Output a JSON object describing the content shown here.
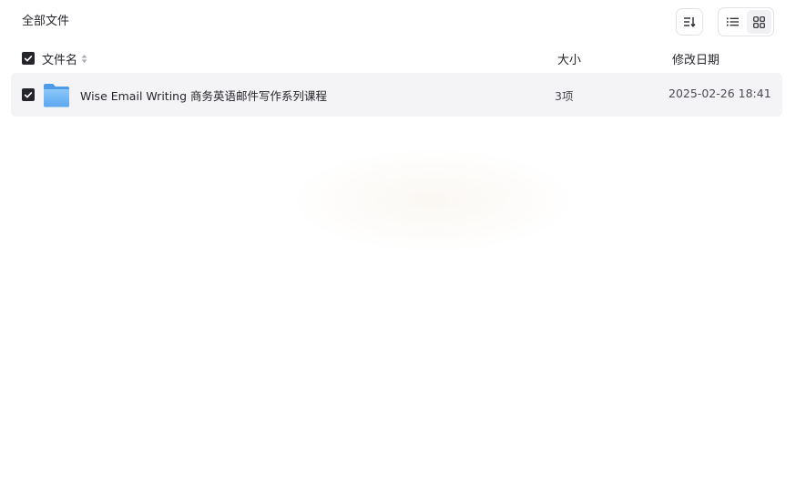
{
  "header": {
    "title": "全部文件"
  },
  "toolbar": {
    "sort_icon": "sort-descending-icon",
    "list_view_icon": "list-view-icon",
    "grid_view_icon": "grid-view-icon",
    "active_view": "list"
  },
  "columns": {
    "name": "文件名",
    "size": "大小",
    "date": "修改日期"
  },
  "files": [
    {
      "name": "Wise Email Writing 商务英语邮件写作系列课程",
      "size": "3项",
      "date": "2025-02-26 18:41",
      "type": "folder",
      "checked": true
    }
  ],
  "colors": {
    "text": "#25262b",
    "row_bg": "#f4f4f6",
    "folder": "#6fb3f2"
  }
}
